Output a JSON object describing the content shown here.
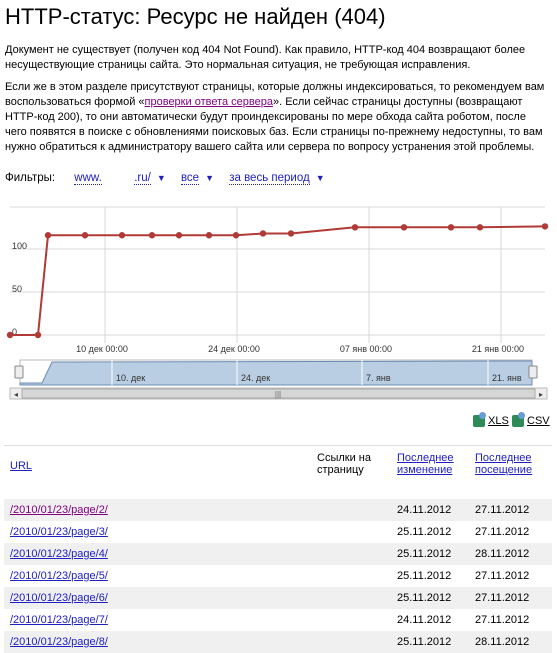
{
  "page": {
    "title": "HTTP-статус: Ресурс не найден (404)",
    "para1": "Документ не существует (получен код 404 Not Found). Как правило, HTTP-код 404 возвращают более несуществующие страницы сайта. Это нормальная ситуация, не требующая исправления.",
    "para2_a": "Если же в этом разделе присутствуют страницы, которые должны индексироваться, то рекомендуем вам воспользоваться формой «",
    "para2_link": "проверки ответа сервера",
    "para2_b": "». Если сейчас страницы доступны (возвращают HTTP-код 200), то они автоматически будут проиндексированы по мере обхода сайта роботом, после чего появятся в поиске с обновлениями поисковых баз. Если страницы по-прежнему недоступны, то вам нужно обратиться к администратору вашего сайта или сервера по вопросу устранения этой проблемы."
  },
  "filters": {
    "label": "Фильтры:",
    "site_a": "www.",
    "site_b": ".ru/",
    "scope": "все",
    "period": "за весь период"
  },
  "chart_data": {
    "type": "line",
    "color": "#b03a35",
    "x": [
      "2012-11-27",
      "2012-12-01",
      "2012-12-08",
      "2012-12-12",
      "2012-12-15",
      "2012-12-19",
      "2012-12-22",
      "2012-12-24",
      "2012-12-26",
      "2012-12-29",
      "2013-01-05",
      "2013-01-09",
      "2013-01-13",
      "2013-01-16",
      "2013-01-20"
    ],
    "values": [
      0,
      0,
      113,
      113,
      113,
      113,
      113,
      113,
      113,
      115,
      115,
      122,
      122,
      122,
      122,
      123
    ],
    "y_ticks": [
      "100",
      "50",
      "0"
    ],
    "x_ticks": [
      "10 дек 00:00",
      "24 дек 00:00",
      "07 янв 00:00",
      "21 янв 00:00"
    ],
    "nav_ticks": [
      "10. дек",
      "24. дек",
      "7. янв",
      "21. янв"
    ],
    "ylim": [
      0,
      145
    ]
  },
  "exports": {
    "xls": "XLS",
    "csv": "CSV"
  },
  "table": {
    "col_url": "URL",
    "col_links": "Ссылки на страницу",
    "col_changed": "Последнее изменение",
    "col_visit": "Последнее посещение",
    "rows": [
      {
        "url": "/2010/01/23/page/2/",
        "changed": "24.11.2012",
        "visit": "27.11.2012"
      },
      {
        "url": "/2010/01/23/page/3/",
        "changed": "25.11.2012",
        "visit": "27.11.2012"
      },
      {
        "url": "/2010/01/23/page/4/",
        "changed": "25.11.2012",
        "visit": "28.11.2012"
      },
      {
        "url": "/2010/01/23/page/5/",
        "changed": "25.11.2012",
        "visit": "27.11.2012"
      },
      {
        "url": "/2010/01/23/page/6/",
        "changed": "25.11.2012",
        "visit": "27.11.2012"
      },
      {
        "url": "/2010/01/23/page/7/",
        "changed": "24.11.2012",
        "visit": "27.11.2012"
      },
      {
        "url": "/2010/01/23/page/8/",
        "changed": "25.11.2012",
        "visit": "28.11.2012"
      }
    ]
  }
}
